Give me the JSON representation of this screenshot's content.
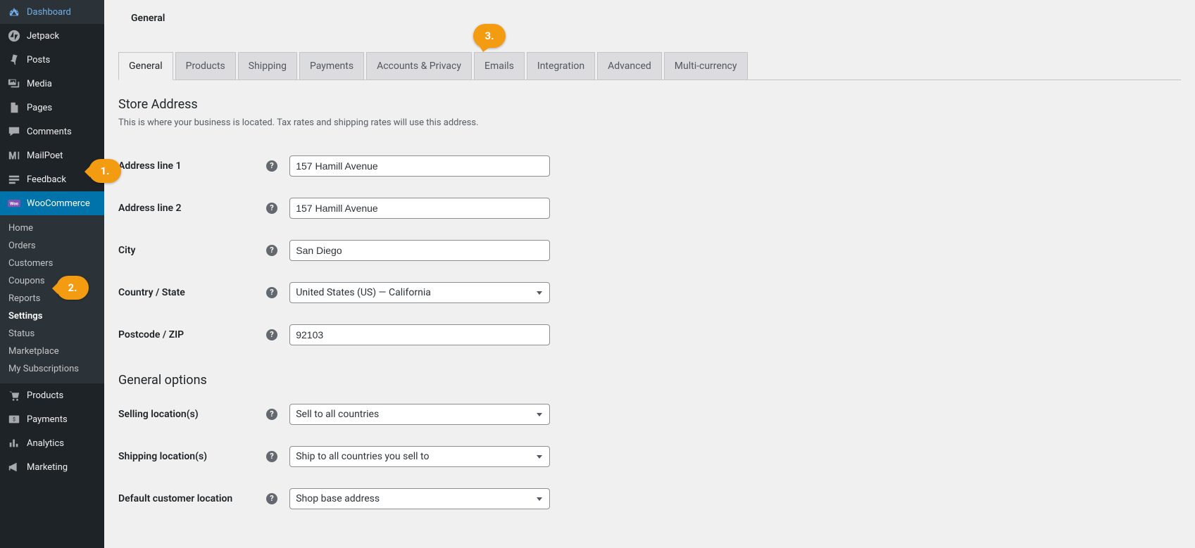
{
  "sidebar": {
    "main": [
      {
        "icon": "dashboard",
        "label": "Dashboard"
      },
      {
        "icon": "jetpack",
        "label": "Jetpack"
      },
      {
        "icon": "pin",
        "label": "Posts"
      },
      {
        "icon": "media",
        "label": "Media"
      },
      {
        "icon": "page",
        "label": "Pages"
      },
      {
        "icon": "comment",
        "label": "Comments"
      },
      {
        "icon": "mailpoet",
        "label": "MailPoet"
      },
      {
        "icon": "feedback",
        "label": "Feedback"
      },
      {
        "icon": "woo",
        "label": "WooCommerce",
        "current": true
      }
    ],
    "woo_sub": [
      {
        "label": "Home"
      },
      {
        "label": "Orders"
      },
      {
        "label": "Customers"
      },
      {
        "label": "Coupons"
      },
      {
        "label": "Reports"
      },
      {
        "label": "Settings",
        "current": true
      },
      {
        "label": "Status"
      },
      {
        "label": "Marketplace"
      },
      {
        "label": "My Subscriptions"
      }
    ],
    "main2": [
      {
        "icon": "products",
        "label": "Products"
      },
      {
        "icon": "payments",
        "label": "Payments"
      },
      {
        "icon": "analytics",
        "label": "Analytics"
      },
      {
        "icon": "marketing",
        "label": "Marketing"
      }
    ]
  },
  "page": {
    "title": "General"
  },
  "tabs": [
    {
      "label": "General",
      "active": true
    },
    {
      "label": "Products"
    },
    {
      "label": "Shipping"
    },
    {
      "label": "Payments"
    },
    {
      "label": "Accounts & Privacy"
    },
    {
      "label": "Emails"
    },
    {
      "label": "Integration"
    },
    {
      "label": "Advanced"
    },
    {
      "label": "Multi-currency"
    }
  ],
  "sections": {
    "store_address": {
      "title": "Store Address",
      "desc": "This is where your business is located. Tax rates and shipping rates will use this address.",
      "fields": {
        "address1": {
          "label": "Address line 1",
          "value": "157 Hamill Avenue"
        },
        "address2": {
          "label": "Address line 2",
          "value": "157 Hamill Avenue"
        },
        "city": {
          "label": "City",
          "value": "San Diego"
        },
        "country": {
          "label": "Country / State",
          "value": "United States (US) — California"
        },
        "postcode": {
          "label": "Postcode / ZIP",
          "value": "92103"
        }
      }
    },
    "general_options": {
      "title": "General options",
      "fields": {
        "selling": {
          "label": "Selling location(s)",
          "value": "Sell to all countries"
        },
        "shipping": {
          "label": "Shipping location(s)",
          "value": "Ship to all countries you sell to"
        },
        "default_loc": {
          "label": "Default customer location",
          "value": "Shop base address"
        }
      }
    }
  },
  "callouts": {
    "one": "1.",
    "two": "2.",
    "three": "3."
  }
}
